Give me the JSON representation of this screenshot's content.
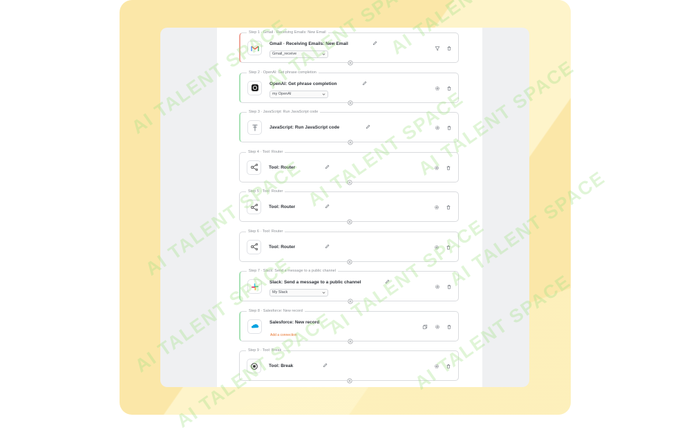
{
  "watermark": "AI TALENT SPACE",
  "colors": {
    "background_card": "#fbe7a8",
    "panel": "#eff0f2",
    "canvas": "#ffffff",
    "accent_red": "#f0a59a",
    "accent_green": "#a8e2b6",
    "link_orange": "#e8732b"
  },
  "steps": [
    {
      "tag": "Step 1 · Gmail · Receiving Emails: New Email",
      "title": "Gmail · Receiving Emails: New Email",
      "icon": "gmail-icon",
      "select": "Gmail_receive",
      "actions": [
        "filter-icon",
        "trash-icon"
      ]
    },
    {
      "tag": "Step 2 · OpenAI: Get phrase completion",
      "title": "OpenAI: Get phrase completion",
      "icon": "openai-icon",
      "select": "my OpenAI",
      "actions": [
        "gear-icon",
        "trash-icon"
      ]
    },
    {
      "tag": "Step 3 · JavaScript: Run JavaScript code",
      "title": "JavaScript: Run JavaScript code",
      "icon": "javascript-icon",
      "actions": [
        "gear-icon",
        "trash-icon"
      ]
    },
    {
      "tag": "Step 4 · Tool: Router",
      "title": "Tool: Router",
      "icon": "router-icon",
      "actions": [
        "gear-icon",
        "trash-icon"
      ]
    },
    {
      "tag": "Step 5 · Tool: Router",
      "title": "Tool: Router",
      "icon": "router-icon",
      "actions": [
        "gear-icon",
        "trash-icon"
      ]
    },
    {
      "tag": "Step 6 · Tool: Router",
      "title": "Tool: Router",
      "icon": "router-icon",
      "actions": [
        "gear-icon",
        "trash-icon"
      ]
    },
    {
      "tag": "Step 7 · Slack: Send a message to a public channel",
      "title": "Slack: Send a message to a public channel",
      "icon": "slack-icon",
      "select": "My Slack",
      "actions": [
        "gear-icon",
        "trash-icon"
      ]
    },
    {
      "tag": "Step 8 · Salesforce: New record",
      "title": "Salesforce: New record",
      "icon": "salesforce-icon",
      "link": "Add a connection",
      "actions": [
        "copy-icon",
        "gear-icon",
        "trash-icon"
      ]
    },
    {
      "tag": "Step 9 · Tool: Break",
      "title": "Tool: Break",
      "icon": "break-icon",
      "actions": [
        "gear-icon",
        "trash-icon"
      ]
    }
  ]
}
